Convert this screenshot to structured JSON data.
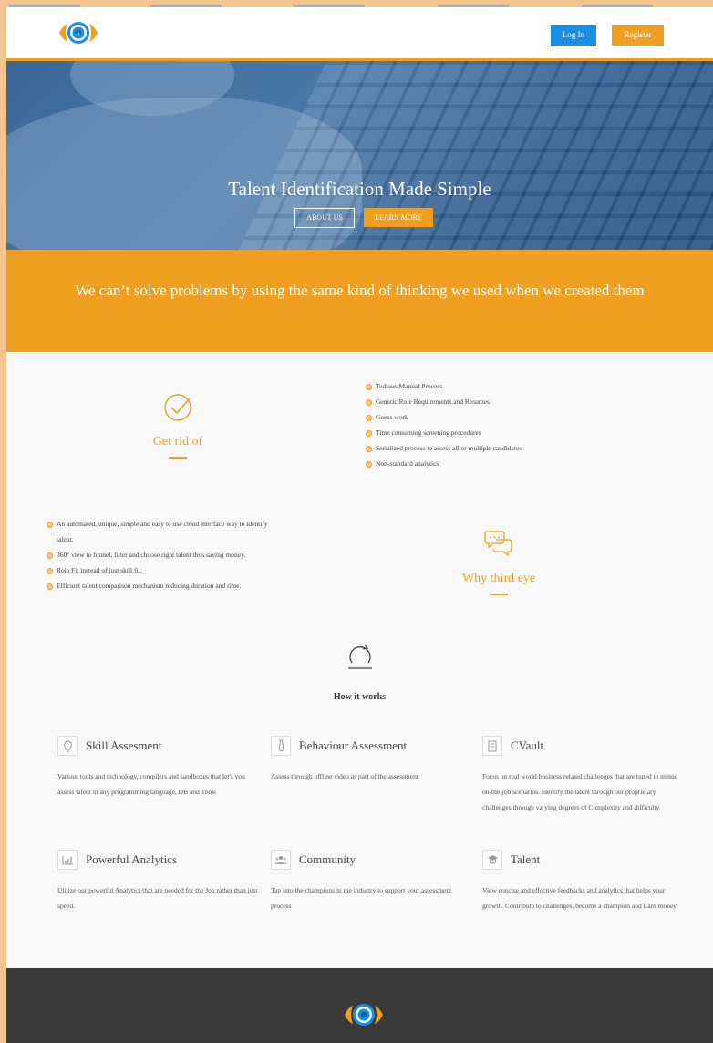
{
  "header": {
    "login_label": "Log In",
    "register_label": "Register"
  },
  "hero": {
    "title": "Talent Identification Made Simple",
    "about_label": "ABOUT US",
    "learn_label": "LEARN MORE"
  },
  "quote": {
    "text": "We can’t solve problems by using the same kind of thinking we used when we created them"
  },
  "get_rid": {
    "title": "Get rid of",
    "items": [
      "Tedious Manual Process",
      "Generic Role Requirements and Resumes",
      "Guess work",
      "Time consuming screening procedures",
      "Serialized process to assess all or multiple candidates",
      "Non-standard analytics"
    ]
  },
  "why": {
    "title": "Why third eye",
    "items": [
      "An automated, unique, simple and easy to use cloud interface way to identify talent.",
      "360° view to funnel, filter and choose right talent thus saving money.",
      "Role Fit instead of just skill fit.",
      "Efficient talent comparison mechanism reducing duration and time."
    ]
  },
  "how": {
    "title": "How it works"
  },
  "features": [
    {
      "title": "Skill Assesment",
      "icon": "bulb-icon",
      "desc": "Various tools and technology, compilers and sandboxes that let's you assess talent in any programming language, DB and Tools"
    },
    {
      "title": "Behaviour Assessment",
      "icon": "tie-icon",
      "desc": "Assess through offline video as part of the assessment"
    },
    {
      "title": "CVault",
      "icon": "vault-icon",
      "desc": "Focus on real world business related challenges that are tuned to mimic on-the-job scenarios. Identify the talent through our proprietary challenges through varying degrees of Complexity and difficulty"
    },
    {
      "title": "Powerful Analytics",
      "icon": "chart-icon",
      "desc": "Utilize our powerful Analytics that are needed for the Job rather than just speed."
    },
    {
      "title": "Community",
      "icon": "community-icon",
      "desc": "Tap into the champions in the industry to support your assessment process"
    },
    {
      "title": "Talent",
      "icon": "graduate-icon",
      "desc": "View concise and effective feedbacks and analytics that helps your growth. Contribute to challenges, become a champion and Earn money"
    }
  ],
  "colors": {
    "accent": "#f0a020",
    "primary": "#1a8ee0",
    "footer": "#3a3a3a"
  }
}
